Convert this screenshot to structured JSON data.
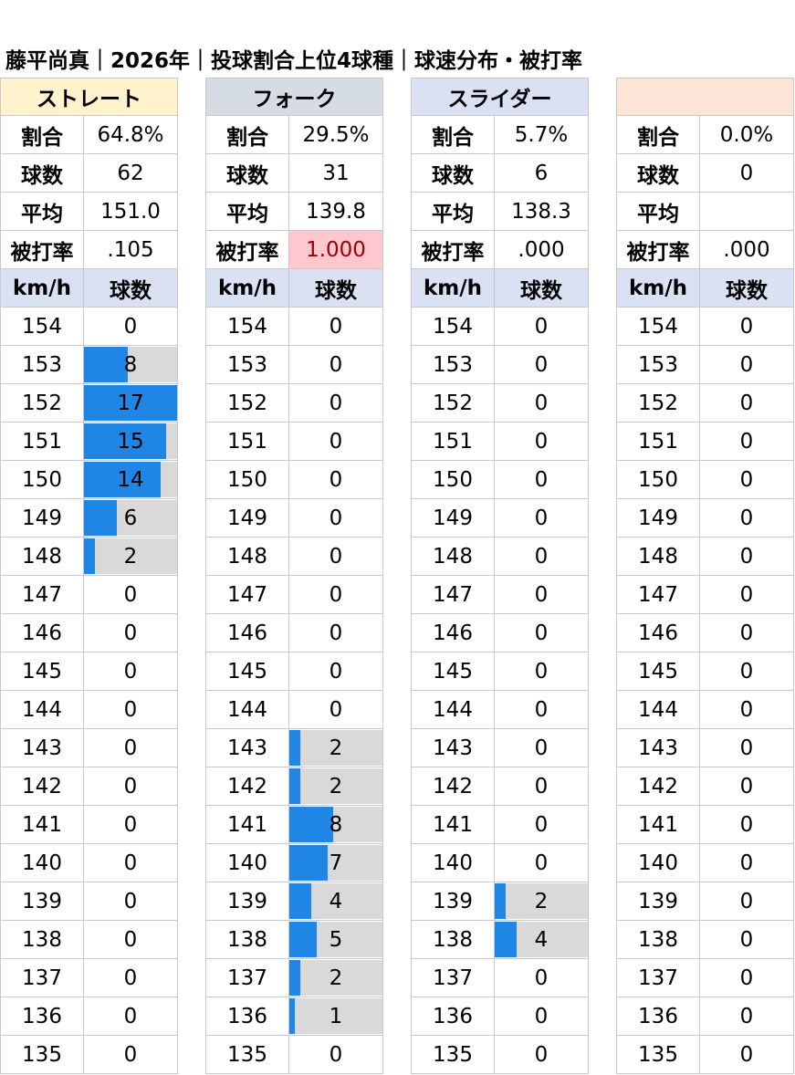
{
  "title": "藤平尚真｜2026年｜投球割合上位4球種｜球速分布・被打率",
  "labels": {
    "ratio": "割合",
    "count": "球数",
    "avg": "平均",
    "babip": "被打率",
    "kmh": "km/h",
    "pitches": "球数"
  },
  "speeds": [
    154,
    153,
    152,
    151,
    150,
    149,
    148,
    147,
    146,
    145,
    144,
    143,
    142,
    141,
    140,
    139,
    138,
    137,
    136,
    135
  ],
  "panels": [
    {
      "name": "ストレート",
      "header_color": "#fff2cc",
      "ratio": "64.8%",
      "count": "62",
      "avg": "151.0",
      "avg_against": ".105",
      "highlight_avg_against": false,
      "counts": [
        0,
        8,
        17,
        15,
        14,
        6,
        2,
        0,
        0,
        0,
        0,
        0,
        0,
        0,
        0,
        0,
        0,
        0,
        0,
        0
      ]
    },
    {
      "name": "フォーク",
      "header_color": "#d6dce4",
      "ratio": "29.5%",
      "count": "31",
      "avg": "139.8",
      "avg_against": "1.000",
      "highlight_avg_against": true,
      "counts": [
        0,
        0,
        0,
        0,
        0,
        0,
        0,
        0,
        0,
        0,
        0,
        2,
        2,
        8,
        7,
        4,
        5,
        2,
        1,
        0
      ]
    },
    {
      "name": "スライダー",
      "header_color": "#d9e1f2",
      "ratio": "5.7%",
      "count": "6",
      "avg": "138.3",
      "avg_against": ".000",
      "highlight_avg_against": false,
      "counts": [
        0,
        0,
        0,
        0,
        0,
        0,
        0,
        0,
        0,
        0,
        0,
        0,
        0,
        0,
        0,
        2,
        4,
        0,
        0,
        0
      ]
    },
    {
      "name": "",
      "header_color": "#fce4d6",
      "ratio": "0.0%",
      "count": "0",
      "avg": "",
      "avg_against": ".000",
      "highlight_avg_against": false,
      "counts": [
        0,
        0,
        0,
        0,
        0,
        0,
        0,
        0,
        0,
        0,
        0,
        0,
        0,
        0,
        0,
        0,
        0,
        0,
        0,
        0
      ]
    }
  ],
  "colors": {
    "bar_fill": "#1f86e6",
    "bar_background": "#d9d9d9",
    "header_row": "#d9e1f2",
    "highlight_bg": "#ffc7ce",
    "highlight_text": "#9c0006"
  }
}
